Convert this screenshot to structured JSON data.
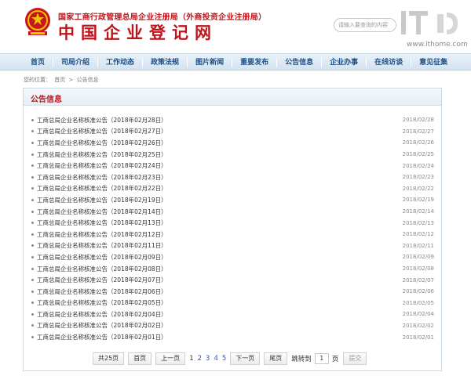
{
  "header": {
    "org_subtitle": "国家工商行政管理总局企业注册局（外商投资企业注册局）",
    "org_title": "中国企业登记网",
    "search_placeholder": "请输入要查询的内容",
    "watermark_url": "www.ithome.com",
    "accent_color": "#c0141b"
  },
  "nav": {
    "items": [
      "首页",
      "司局介绍",
      "工作动态",
      "政策法规",
      "图片新闻",
      "重要发布",
      "公告信息",
      "企业办事",
      "在线访谈",
      "意见征集"
    ]
  },
  "breadcrumb": {
    "prefix": "您的位置：",
    "home": "首页",
    "separator": ">",
    "current": "公告信息"
  },
  "panel": {
    "title": "公告信息"
  },
  "list": [
    {
      "title": "工商总局企业名称核准公告（2018年02月28日）",
      "date": "2018/02/28"
    },
    {
      "title": "工商总局企业名称核准公告（2018年02月27日）",
      "date": "2018/02/27"
    },
    {
      "title": "工商总局企业名称核准公告（2018年02月26日）",
      "date": "2018/02/26"
    },
    {
      "title": "工商总局企业名称核准公告（2018年02月25日）",
      "date": "2018/02/25"
    },
    {
      "title": "工商总局企业名称核准公告（2018年02月24日）",
      "date": "2018/02/24"
    },
    {
      "title": "工商总局企业名称核准公告（2018年02月23日）",
      "date": "2018/02/23"
    },
    {
      "title": "工商总局企业名称核准公告（2018年02月22日）",
      "date": "2018/02/22"
    },
    {
      "title": "工商总局企业名称核准公告（2018年02月19日）",
      "date": "2018/02/19"
    },
    {
      "title": "工商总局企业名称核准公告（2018年02月14日）",
      "date": "2018/02/14"
    },
    {
      "title": "工商总局企业名称核准公告（2018年02月13日）",
      "date": "2018/02/13"
    },
    {
      "title": "工商总局企业名称核准公告（2018年02月12日）",
      "date": "2018/02/12"
    },
    {
      "title": "工商总局企业名称核准公告（2018年02月11日）",
      "date": "2018/02/11"
    },
    {
      "title": "工商总局企业名称核准公告（2018年02月09日）",
      "date": "2018/02/09"
    },
    {
      "title": "工商总局企业名称核准公告（2018年02月08日）",
      "date": "2018/02/08"
    },
    {
      "title": "工商总局企业名称核准公告（2018年02月07日）",
      "date": "2018/02/07"
    },
    {
      "title": "工商总局企业名称核准公告（2018年02月06日）",
      "date": "2018/02/06"
    },
    {
      "title": "工商总局企业名称核准公告（2018年02月05日）",
      "date": "2018/02/05"
    },
    {
      "title": "工商总局企业名称核准公告（2018年02月04日）",
      "date": "2018/02/04"
    },
    {
      "title": "工商总局企业名称核准公告（2018年02月02日）",
      "date": "2018/02/02"
    },
    {
      "title": "工商总局企业名称核准公告（2018年02月01日）",
      "date": "2018/02/01"
    }
  ],
  "pager": {
    "total": "共25页",
    "first": "首页",
    "prev": "上一页",
    "pages": [
      "1",
      "2",
      "3",
      "4",
      "5"
    ],
    "current_page": "1",
    "next": "下一页",
    "last": "尾页",
    "jump_label": "跳转到",
    "jump_value": "1",
    "page_unit": "页",
    "submit": "提交"
  }
}
